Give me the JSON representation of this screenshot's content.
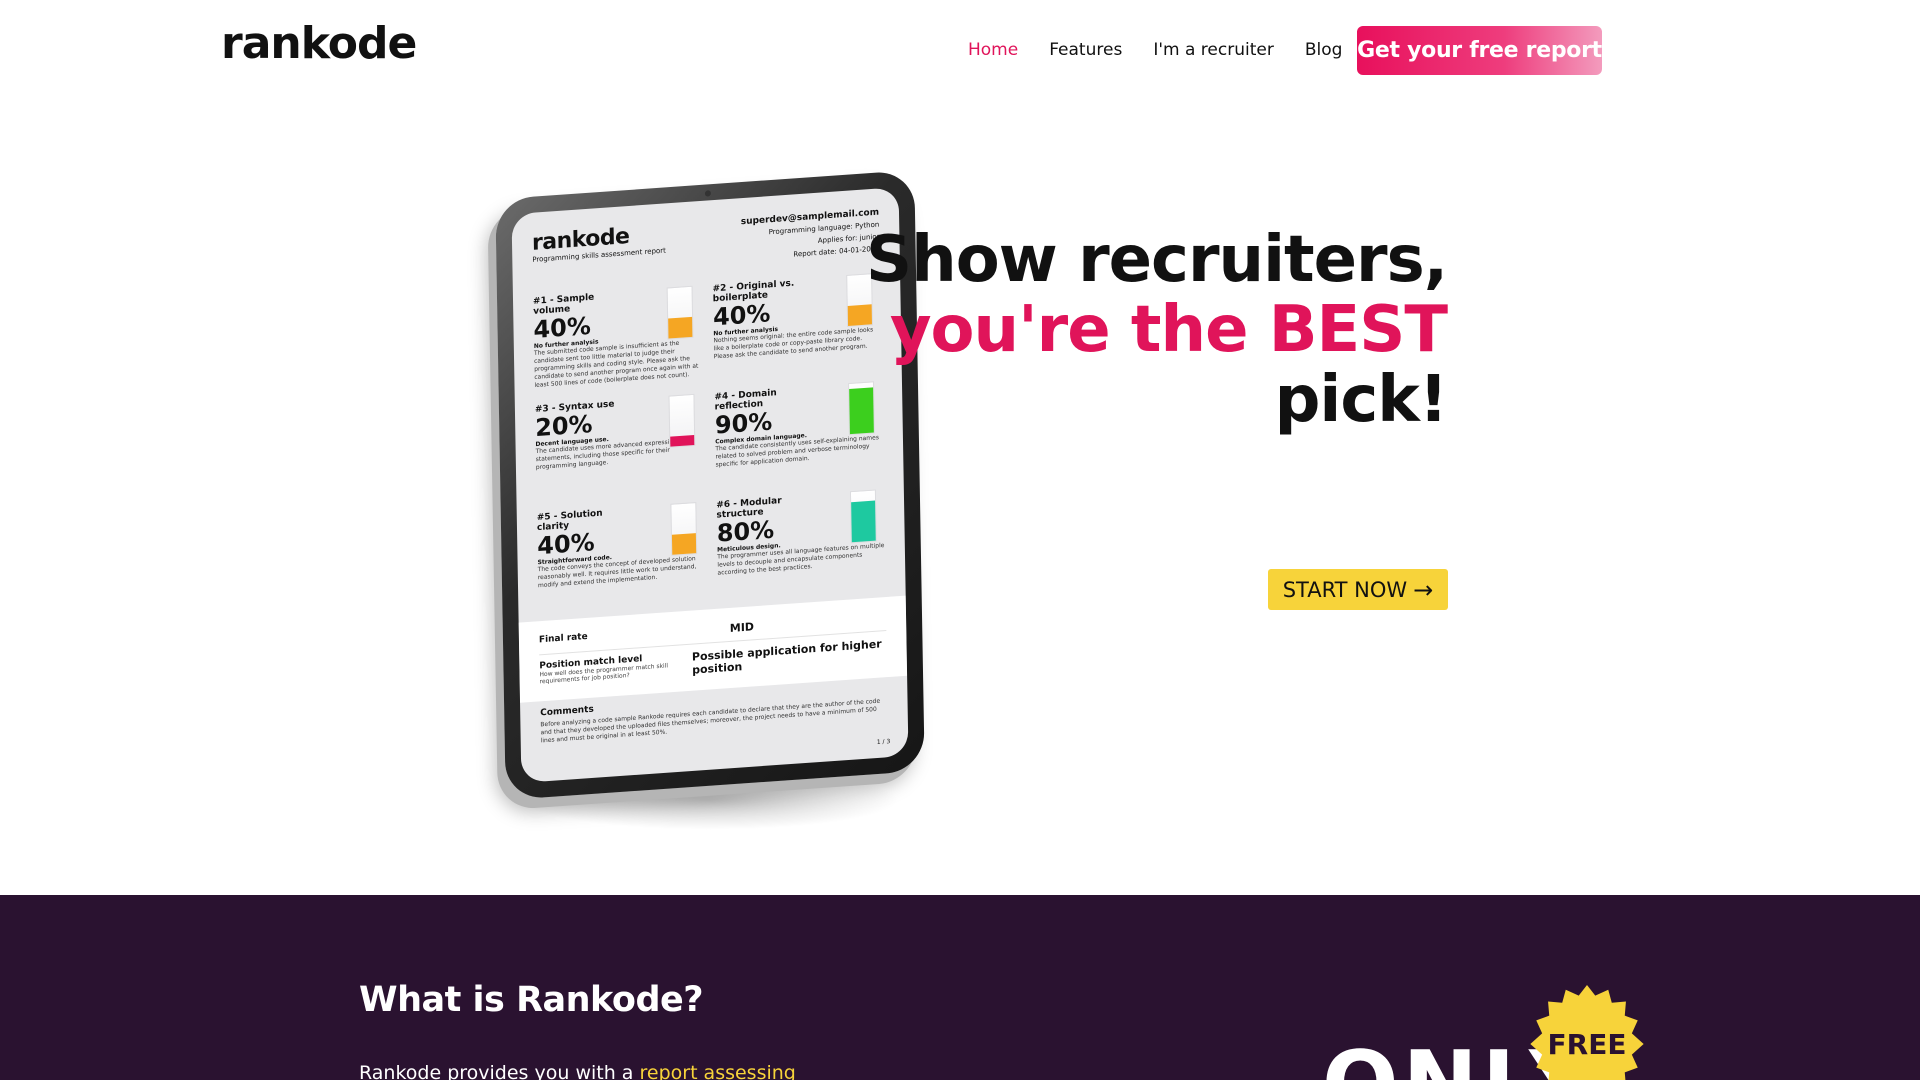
{
  "header": {
    "logo": "rankode",
    "nav": [
      {
        "label": "Home"
      },
      {
        "label": "Features"
      },
      {
        "label": "I'm a recruiter"
      },
      {
        "label": "Blog"
      }
    ],
    "cta_label": "Get your free report"
  },
  "hero": {
    "line1": "Show recruiters,",
    "line2": "you're the BEST",
    "line3": "pick!",
    "start_label": "START NOW",
    "accent_color": "#e0145a",
    "button_color": "#f7d33a"
  },
  "report": {
    "brand": "rankode",
    "subtitle": "Programming skills assessment report",
    "email": "superdev@samplemail.com",
    "language": "Programming language: Python",
    "applies": "Applies for: junior",
    "date": "Report date: 04-01-2023",
    "metrics": [
      {
        "title": "#1 - Sample volume",
        "value": "40%",
        "level": 0.4,
        "color": "#f5a623",
        "sub": "No further analysis",
        "desc": "The submitted code sample is insufficient as the candidate sent too little material to judge their programming skills and coding style. Please ask the candidate to send another program once again with at least 500 lines of code (boilerplate does not count)."
      },
      {
        "title": "#2 - Original vs. boilerplate",
        "value": "40%",
        "level": 0.4,
        "color": "#f5a623",
        "sub": "No further analysis",
        "desc": "Nothing seems original: the entire code sample looks like a boilerplate code or copy-paste library code. Please ask the candidate to send another program."
      },
      {
        "title": "#3 - Syntax use",
        "value": "20%",
        "level": 0.2,
        "color": "#e0145a",
        "sub": "Decent language use.",
        "desc": "The candidate uses more advanced expressions and statements, including those specific for their programming language."
      },
      {
        "title": "#4 - Domain reflection",
        "value": "90%",
        "level": 0.9,
        "color": "#3ccf1e",
        "sub": "Complex domain language.",
        "desc": "The candidate consistently uses self-explaining names related to solved problem and verbose terminology specific for application domain."
      },
      {
        "title": "#5 - Solution clarity",
        "value": "40%",
        "level": 0.4,
        "color": "#f5a623",
        "sub": "Straightforward code.",
        "desc": "The code conveys the concept of developed solution reasonably well. It requires little work to understand, modify and extend the implementation."
      },
      {
        "title": "#6 - Modular structure",
        "value": "80%",
        "level": 0.8,
        "color": "#1ec9a0",
        "sub": "Meticulous design.",
        "desc": "The programmer uses all language features on multiple levels to decouple and encapsulate components according to the best practices."
      }
    ],
    "final_rate_label": "Final rate",
    "final_rate_value": "MID",
    "position_label": "Position match level",
    "position_hint": "How well does the programmer match skill requirements for job position?",
    "position_value": "Possible application for higher position",
    "comments_title": "Comments",
    "comments_text": "Before analyzing a code sample Rankode requires each candidate to declare that they are the author of the code and that they developed the uploaded files themselves; moreover, the project needs to have a minimum of 500 lines and must be original in at least 50%.",
    "page": "1 / 3"
  },
  "about": {
    "heading": "What is Rankode?",
    "text_prefix": "Rankode provides you with a ",
    "text_link": "report assessing",
    "only": "ONLY",
    "badge": "FREE",
    "bg_color": "#2a1230",
    "badge_color": "#f7d33a"
  }
}
